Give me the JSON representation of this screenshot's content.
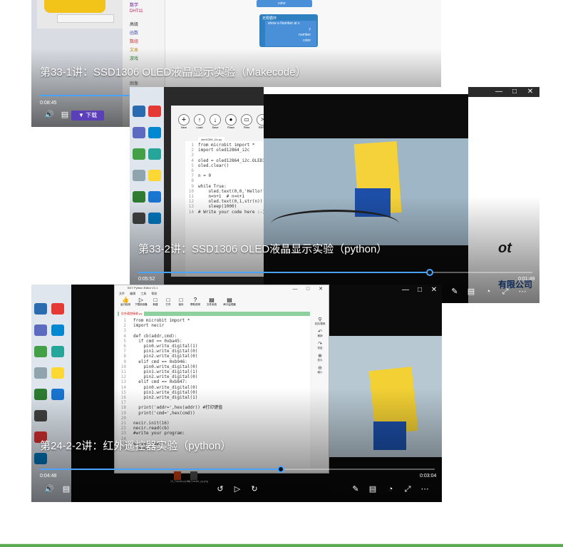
{
  "videos": [
    {
      "title": "第33-1讲：SSD1306 OLED液晶显示实验（Makecode）",
      "elapsed": "0:08:45",
      "progress": 0.5,
      "download_label": "下载",
      "sidebar_items": [
        "数学",
        "DHT11",
        "高级",
        "函数",
        "数组",
        "文本",
        "游戏",
        "图像"
      ],
      "blocks": [
        "color",
        "无限循环",
        "show a Number at x",
        "y",
        "number",
        "color"
      ]
    },
    {
      "title": "第33-2讲：SSD1306 OLED液晶显示实验（python）",
      "elapsed": "0:05:52",
      "duration": "0:01:49",
      "progress": 0.74,
      "toolbar_labels": [
        "New",
        "Load",
        "Save",
        "Flash",
        "Files",
        "REPL"
      ],
      "tab_label": "oled1306_i2c.py",
      "code_lines": [
        "from microbit import *",
        "import oled12864_i2c",
        "",
        "oled = oled12864_i2c.OLED12864_I2C()",
        "oled.clear()",
        "",
        "n = 0",
        "",
        "while True:",
        "    oled.text(0,0,'Hello!')",
        "    n=n+1  # n=n+1",
        "    oled.text(0,1,str(n))",
        "    sleep(1000)",
        "# Write your code here :-)"
      ],
      "banner_text": "有限公司",
      "banner_text2": "ot"
    },
    {
      "title": "第24-2-2讲：红外遥控器实验（python）",
      "elapsed": "0:04:48",
      "duration": "0:03:04",
      "progress": 0.61,
      "app_title": "BXY Python Editor V1.1",
      "menu_items": [
        "文件",
        "编辑",
        "工具",
        "帮助"
      ],
      "toolbar_labels": [
        "运行检测",
        "下载到设备",
        "新建",
        "打开",
        "保存",
        "帮助说明",
        "文件系统",
        "串口监视器"
      ],
      "tab_label": "红外遥控接收.py",
      "right_tools": [
        "查找/替换",
        "撤销",
        "恢复",
        "放大",
        "缩小"
      ],
      "code_lines": [
        "from microbit import *",
        "import necir",
        "",
        "def cb(addr,cmd):",
        "  if cmd == 0xba45:",
        "    pin0.write_digital(1)",
        "    pin1.write_digital(0)",
        "    pin2.write_digital(0)",
        "  elif cmd == 0xb946:",
        "    pin0.write_digital(0)",
        "    pin1.write_digital(1)",
        "    pin2.write_digital(0)",
        "  elif cmd == 0xb847:",
        "    pin0.write_digital(0)",
        "    pin1.write_digital(0)",
        "    pin2.write_digital(1)",
        "",
        "  print('addr=',hex(addr)) #打印键值",
        "  print('cmd=',hex(cmd))",
        "",
        "necir.init(16)",
        "necir.read(cb)",
        "#write your program:",
        "",
        "while True:",
        "  pass"
      ],
      "taskbar_files": [
        "10_Tracker.py.hex",
        "10_Tracker_py.png"
      ]
    }
  ],
  "colors": {
    "accent": "#4aa3ff",
    "download": "#5b3fb8",
    "footer": "#5aaa50"
  }
}
